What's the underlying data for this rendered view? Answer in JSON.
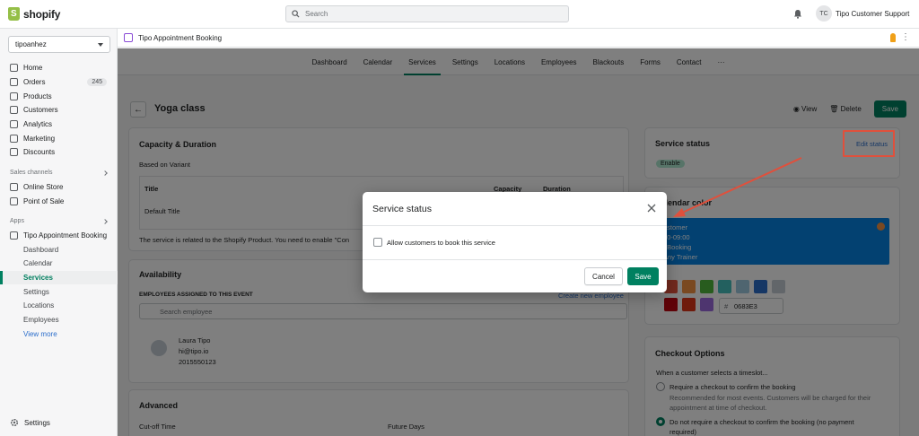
{
  "topbar": {
    "brand": "shopify",
    "search_placeholder": "Search",
    "avatar_initials": "TC",
    "user_name": "Tipo Customer Support"
  },
  "sidebar": {
    "store": "tipoanhez",
    "items": [
      {
        "label": "Home"
      },
      {
        "label": "Orders",
        "badge": "245"
      },
      {
        "label": "Products"
      },
      {
        "label": "Customers"
      },
      {
        "label": "Analytics"
      },
      {
        "label": "Marketing"
      },
      {
        "label": "Discounts"
      }
    ],
    "sales_channels_label": "Sales channels",
    "channels": [
      {
        "label": "Online Store"
      },
      {
        "label": "Point of Sale"
      }
    ],
    "apps_label": "Apps",
    "app_name": "Tipo Appointment Booking",
    "app_subitems": [
      "Dashboard",
      "Calendar",
      "Services",
      "Settings",
      "Locations",
      "Employees"
    ],
    "view_more": "View more",
    "settings": "Settings"
  },
  "appbar": {
    "title": "Tipo Appointment Booking"
  },
  "tabs": [
    "Dashboard",
    "Calendar",
    "Services",
    "Settings",
    "Locations",
    "Employees",
    "Blackouts",
    "Forms",
    "Contact",
    "···"
  ],
  "page": {
    "title": "Yoga class",
    "view": "View",
    "delete": "Delete",
    "save": "Save",
    "capacity": {
      "title": "Capacity & Duration",
      "subtitle": "Based on Variant",
      "col_title": "Title",
      "col_capacity": "Capacity",
      "col_duration": "Duration",
      "row_title": "Default Title",
      "note": "The service is related to the Shopify Product. You need to enable \"Con"
    },
    "availability": {
      "title": "Availability",
      "employees_label": "EMPLOYEES ASSIGNED TO THIS EVENT",
      "create_link": "Create new employee",
      "search_placeholder": "Search employee",
      "employee_name": "Laura Tipo",
      "employee_email": "hi@tipo.io",
      "employee_phone": "2015550123"
    },
    "advanced": {
      "title": "Advanced",
      "cutoff": "Cut-off Time",
      "future": "Future Days"
    },
    "service_status": {
      "title": "Service status",
      "edit": "Edit status",
      "badge": "Enable"
    },
    "calendar_color": {
      "title": "Calendar color",
      "preview_lines": [
        "ustomer",
        "00-09:00",
        "t Booking",
        "Any Trainer"
      ],
      "swatches": [
        "#e5533d",
        "#f49342",
        "#50b83c",
        "#47c1bf",
        "#9ecae1",
        "#2c6ecb",
        "#c4cdd5",
        "#bf0711",
        "#de3618",
        "#9c6ade"
      ],
      "hex_prefix": "#",
      "hex_value": "0683E3"
    },
    "checkout": {
      "title": "Checkout Options",
      "prompt": "When a customer selects a timeslot...",
      "opt1": "Require a checkout to confirm the booking",
      "opt1_desc1": "Recommended for most events. Customers will be charged for their",
      "opt1_desc2": "appointment at time of checkout.",
      "opt2": "Do not require a checkout to confirm the booking (no payment",
      "opt2_cont": "required)"
    }
  },
  "modal": {
    "title": "Service status",
    "checkbox_label": "Allow customers to book this service",
    "cancel": "Cancel",
    "save": "Save"
  }
}
